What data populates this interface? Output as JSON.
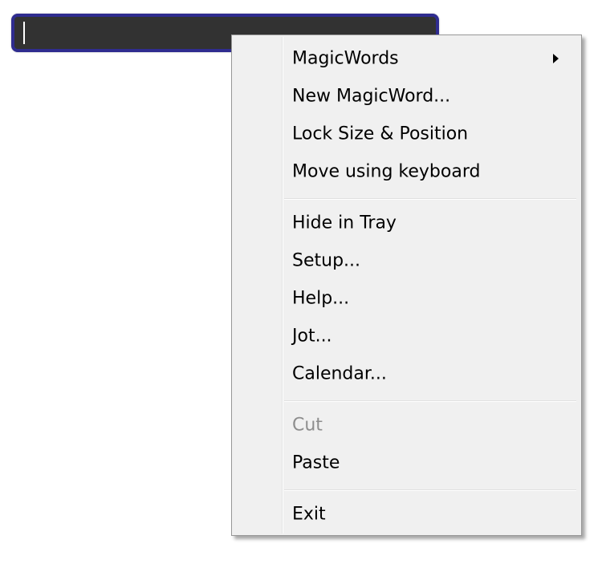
{
  "input_bar": {
    "value": ""
  },
  "context_menu": {
    "items": [
      {
        "label": "MagicWords",
        "has_submenu": true
      },
      {
        "label": "New MagicWord..."
      },
      {
        "label": "Lock Size & Position"
      },
      {
        "label": "Move using keyboard"
      },
      {
        "label": "Hide in Tray"
      },
      {
        "label": "Setup..."
      },
      {
        "label": "Help..."
      },
      {
        "label": "Jot..."
      },
      {
        "label": "Calendar..."
      },
      {
        "label": "Cut",
        "disabled": true
      },
      {
        "label": "Paste"
      },
      {
        "label": "Exit"
      }
    ]
  },
  "colors": {
    "input_background": "#323232",
    "input_border": "#2f2c8f",
    "menu_background": "#f0f0f0",
    "disabled_text": "#8d8d8d"
  },
  "icons": {
    "submenu": "chevron-right-icon"
  }
}
